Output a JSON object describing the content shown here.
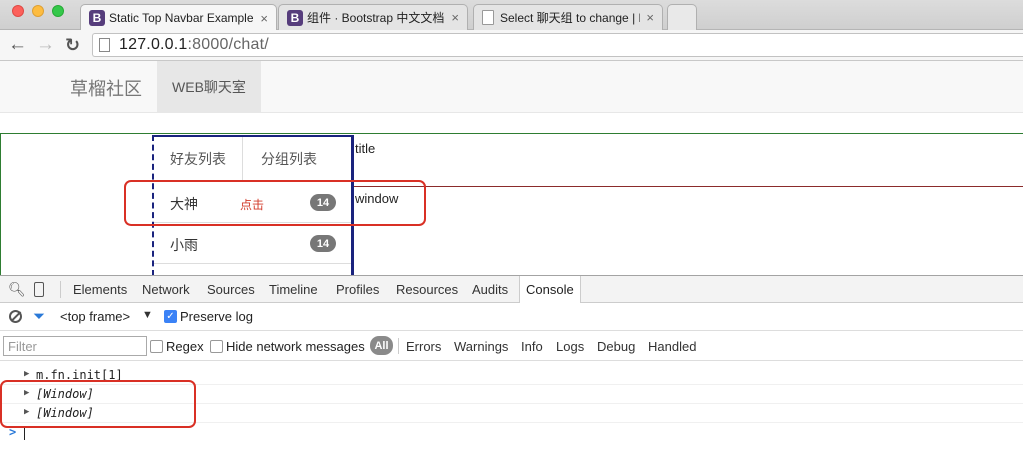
{
  "browser": {
    "tabs": [
      {
        "favicon": "B",
        "title": "Static Top Navbar Example",
        "close": "×"
      },
      {
        "favicon": "B",
        "title": "组件 · Bootstrap 中文文档",
        "close": "×"
      },
      {
        "favicon": "",
        "title": "Select 聊天组 to change | D",
        "close": "×"
      }
    ],
    "address": {
      "host": "127.0.0.1",
      "path": ":8000/chat/"
    }
  },
  "navbar": {
    "brand": "草榴社区",
    "active_item": "WEB聊天室"
  },
  "chat": {
    "tabs": {
      "friends": "好友列表",
      "groups": "分组列表"
    },
    "friends": [
      {
        "name": "大神",
        "hint": "点击",
        "badge": "14"
      },
      {
        "name": "小雨",
        "hint": "",
        "badge": "14"
      }
    ],
    "title_label": "title",
    "window_label": "window"
  },
  "devtools": {
    "tabs": [
      "Elements",
      "Network",
      "Sources",
      "Timeline",
      "Profiles",
      "Resources",
      "Audits",
      "Console"
    ],
    "frame": "<top frame>",
    "preserve_log": "Preserve log",
    "filter_placeholder": "Filter",
    "regex": "Regex",
    "hide_network": "Hide network messages",
    "levels": {
      "all": "All",
      "items": [
        "Errors",
        "Warnings",
        "Info",
        "Logs",
        "Debug",
        "Handled"
      ]
    },
    "console_lines": [
      "m.fn.init[1]",
      "[Window]",
      "[Window]"
    ],
    "prompt": ">"
  },
  "colors": {
    "annotation_red": "#d93025",
    "panel_border": "#1a237e",
    "badge": "#777777"
  }
}
